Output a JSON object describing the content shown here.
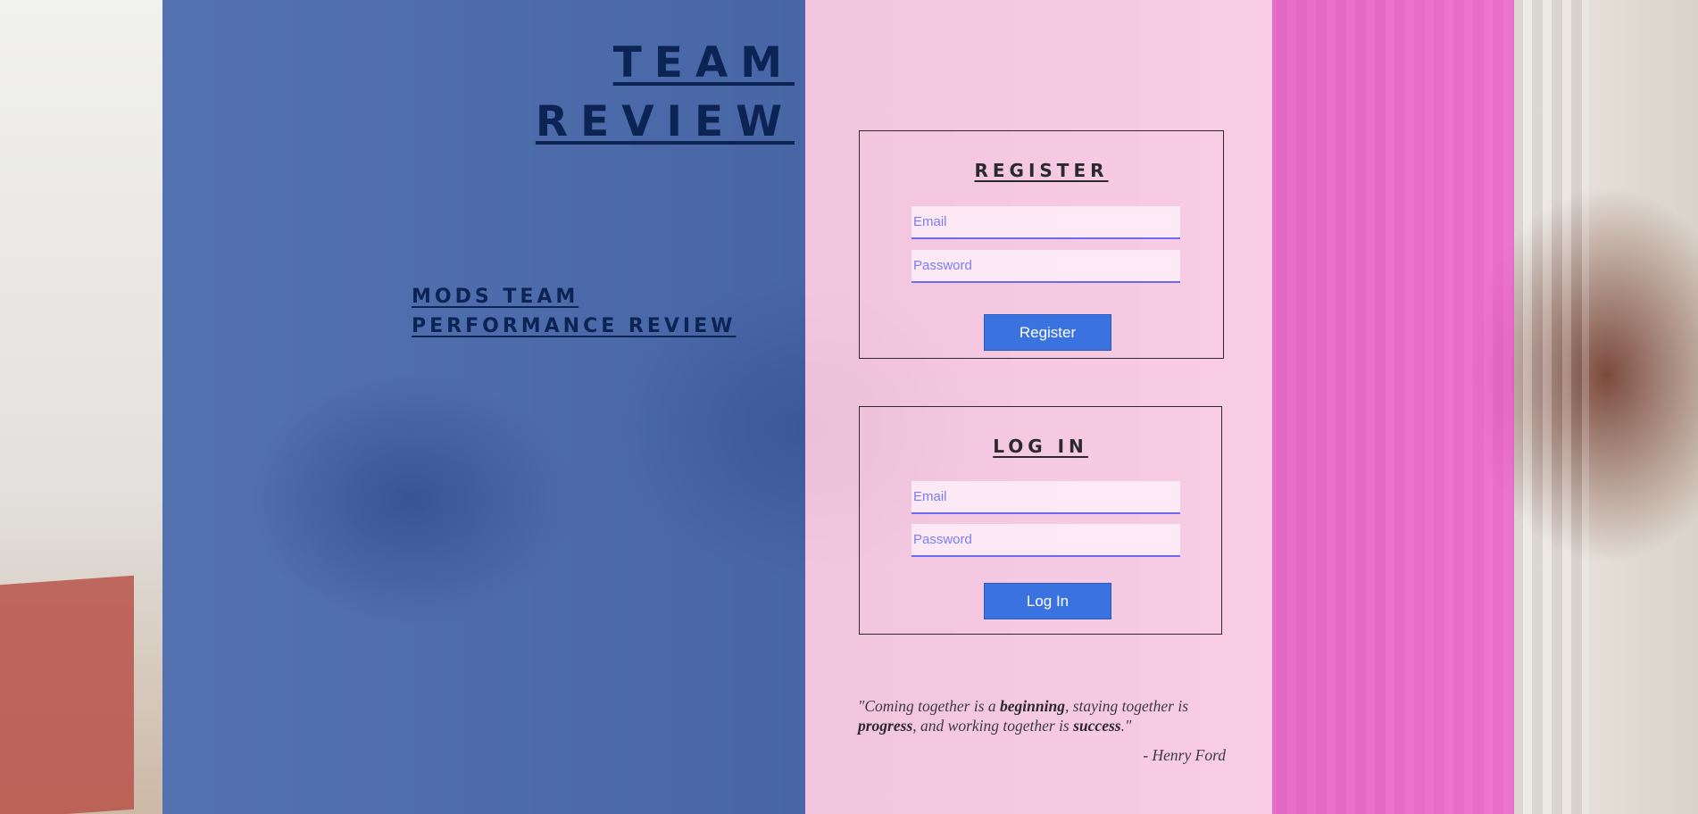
{
  "header": {
    "title_line1": "TEAM",
    "title_line2": "REVIEW",
    "subtitle_line1": "MODS TEAM",
    "subtitle_line2": "PERFORMANCE REVIEW"
  },
  "register": {
    "heading": "REGISTER",
    "email_placeholder": "Email",
    "password_placeholder": "Password",
    "button_label": "Register"
  },
  "login": {
    "heading": "LOG IN",
    "email_placeholder": "Email",
    "password_placeholder": "Password",
    "button_label": "Log In"
  },
  "quote": {
    "part1": "\"Coming together is a ",
    "word1": "beginning",
    "part2": ", staying together is ",
    "word2": "progress",
    "part3": ", and working together is ",
    "word3": "success",
    "part4": ".\"",
    "author": "- Henry Ford"
  },
  "colors": {
    "blue_panel": "#2350aa",
    "pink_panel": "#ffcdeb",
    "magenta_panel": "#ee46c8",
    "button": "#3a72e0",
    "input_accent": "#6a6bf0",
    "title_text": "#0c2454"
  }
}
